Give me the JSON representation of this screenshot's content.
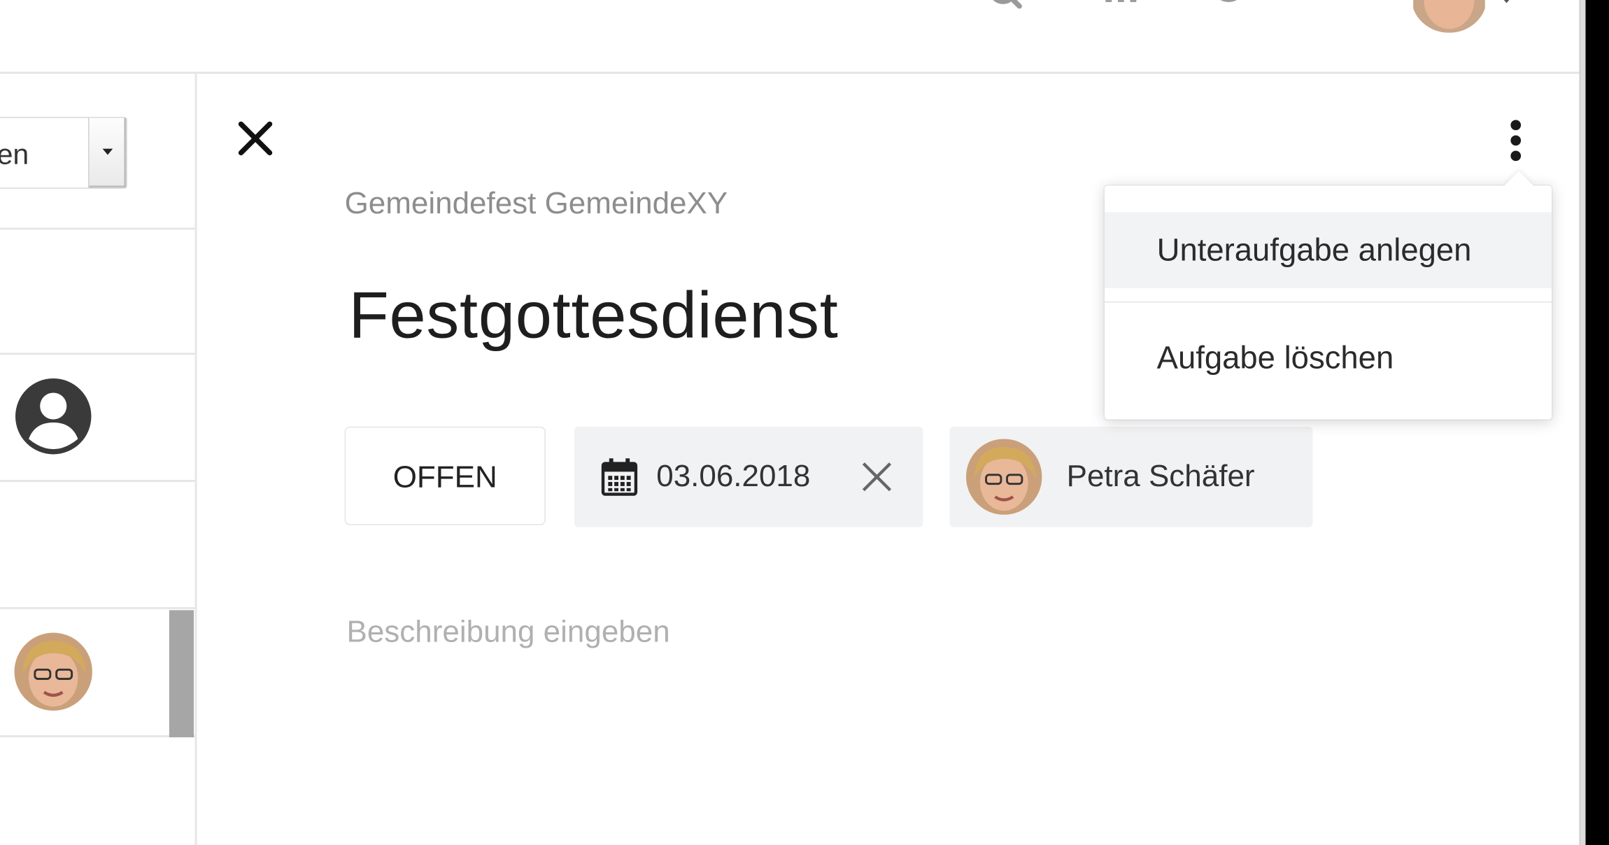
{
  "filter": {
    "selected_value": "en"
  },
  "task": {
    "project": "Gemeindefest GemeindeXY",
    "title": "Festgottesdienst",
    "status": "OFFEN",
    "due_date": "03.06.2018",
    "assignee": "Petra Schäfer",
    "description_placeholder": "Beschreibung eingeben"
  },
  "menu": {
    "items": [
      {
        "label": "Unteraufgabe anlegen"
      },
      {
        "label": "Aufgabe löschen"
      }
    ]
  },
  "icons": {
    "close": "close-icon",
    "kebab": "more-vertical-icon",
    "calendar": "calendar-icon",
    "clear": "clear-date-icon",
    "user": "user-circle-icon",
    "search": "search-icon",
    "team": "team-icon",
    "bell": "bell-icon",
    "help": "help-icon"
  },
  "colors": {
    "chip_background": "#f1f2f4",
    "muted_text": "#8d8d8d",
    "placeholder_text": "#b0b0b0",
    "title_text": "#1e1e1e"
  }
}
